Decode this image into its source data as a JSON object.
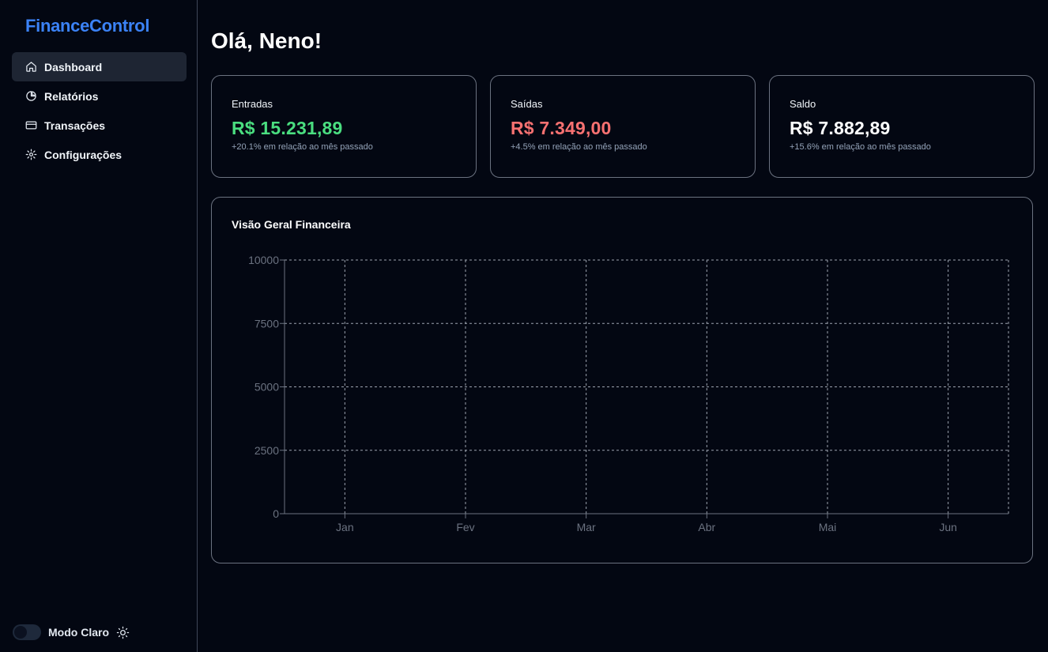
{
  "sidebar": {
    "brand": "FinanceControl",
    "items": [
      {
        "label": "Dashboard",
        "icon": "home-icon",
        "active": true
      },
      {
        "label": "Relatórios",
        "icon": "pie-chart-icon",
        "active": false
      },
      {
        "label": "Transações",
        "icon": "credit-card-icon",
        "active": false
      },
      {
        "label": "Configurações",
        "icon": "gear-icon",
        "active": false
      }
    ],
    "theme_toggle": {
      "label": "Modo Claro",
      "icon": "sun-icon",
      "on": false
    }
  },
  "main": {
    "greeting": "Olá, Neno!",
    "cards": [
      {
        "label": "Entradas",
        "value": "R$ 15.231,89",
        "sub": "+20.1% em relação ao mês passado",
        "color": "#4ade80"
      },
      {
        "label": "Saídas",
        "value": "R$ 7.349,00",
        "sub": "+4.5% em relação ao mês passado",
        "color": "#f87171"
      },
      {
        "label": "Saldo",
        "value": "R$ 7.882,89",
        "sub": "+15.6% em relação ao mês passado",
        "color": "#ffffff"
      }
    ],
    "chart_title": "Visão Geral Financeira"
  },
  "chart_data": {
    "type": "line",
    "title": "Visão Geral Financeira",
    "categories": [
      "Jan",
      "Fev",
      "Mar",
      "Abr",
      "Mai",
      "Jun"
    ],
    "series": [],
    "ylim": [
      0,
      10000
    ],
    "yticks": [
      0,
      2500,
      5000,
      7500,
      10000
    ],
    "grid": true,
    "xlabel": "",
    "ylabel": ""
  }
}
